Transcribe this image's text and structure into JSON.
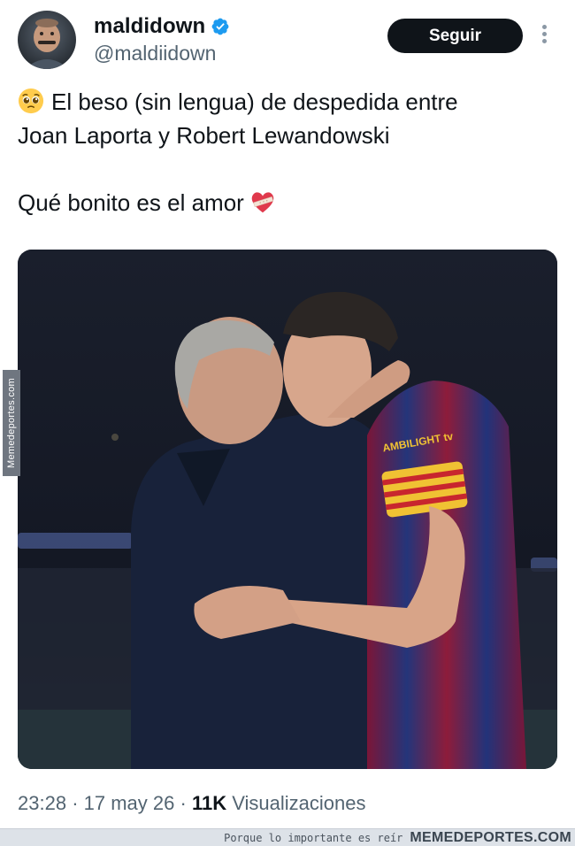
{
  "account": {
    "display_name": "maldidown",
    "handle": "@maldiidown",
    "verified": true,
    "avatar_icon": "profile-avatar"
  },
  "actions": {
    "follow_label": "Seguir",
    "more_icon": "more-options-icon"
  },
  "tweet": {
    "line1": "El beso (sin lengua) de despedida entre",
    "line2": "Joan Laporta y Robert Lewandowski",
    "line3": "Qué bonito es el amor",
    "leading_emoji": "pleading-face-emoji",
    "trailing_emoji": "heart-with-bandage-emoji"
  },
  "media": {
    "alt": "photo",
    "side_watermark": "Memedeportes.com",
    "jersey_sponsor": "AMBILIGHT tv"
  },
  "meta": {
    "time": "23:28",
    "sep1": "·",
    "date": "17 may 26",
    "sep2": "·",
    "views_count": "11K",
    "views_label": "Visualizaciones"
  },
  "footer": {
    "tagline": "Porque lo importante es reír",
    "brand": "MEMEDEPORTES.COM"
  },
  "colors": {
    "text": "#0f1419",
    "secondary": "#536471",
    "verified": "#1d9bf0",
    "button_bg": "#0f1419"
  }
}
